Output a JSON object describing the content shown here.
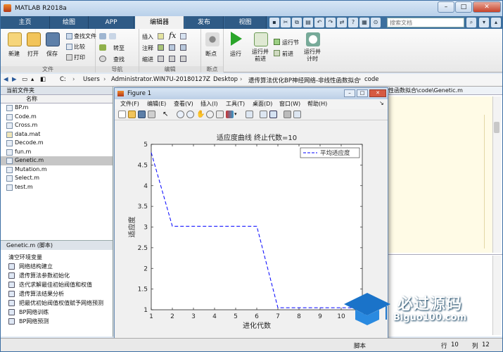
{
  "app_title": "MATLAB R2018a",
  "tabs": [
    "主页",
    "绘图",
    "APP",
    "编辑器",
    "发布",
    "视图"
  ],
  "active_tab": "编辑器",
  "search_placeholder": "搜索文档",
  "ribbon": {
    "new": "新建",
    "open": "打开",
    "save": "保存",
    "find_files": "查找文件",
    "compare": "比较",
    "print": "打印",
    "file_group": "文件",
    "goto": "转至",
    "find": "查找",
    "nav_group": "导航",
    "insert": "插入",
    "comment": "注释",
    "indent": "缩进",
    "fx": "fx",
    "edit_group": "编辑",
    "breakpoints": "断点",
    "bp_group": "断点",
    "run": "运行",
    "run_advance": "运行并\n前进",
    "run_section": "运行节",
    "advance": "前进",
    "run_time": "运行并\n计时"
  },
  "address": [
    "C:",
    "Users",
    "Administrator.WIN7U-20180127Z",
    "Desktop",
    "遗传算法优化BP神经网络-非线性函数拟合",
    "code"
  ],
  "current_folder_title": "当前文件夹",
  "name_col": "名称",
  "files": [
    "BP.m",
    "Code.m",
    "Cross.m",
    "data.mat",
    "Decode.m",
    "fun.m",
    "Genetic.m",
    "Mutation.m",
    "Select.m",
    "test.m"
  ],
  "selected_file": "Genetic.m",
  "details_title": "Genetic.m  (脚本)",
  "tasks": [
    "清空环境变量",
    "网络结构建立",
    "遗传算法参数初始化",
    "迭代求解最佳初始阀值和权值",
    "遗传算法结果分析",
    "把最优初始阀值权值赋予网络预测",
    "BP网络训练",
    "BP网络预测"
  ],
  "editor_path": "性函数拟合\\code\\Genetic.m",
  "figure": {
    "title": "Figure 1",
    "menu": [
      "文件(F)",
      "编辑(E)",
      "查看(V)",
      "插入(I)",
      "工具(T)",
      "桌面(D)",
      "窗口(W)",
      "帮助(H)"
    ]
  },
  "status": {
    "mode": "脚本",
    "row_label": "行",
    "row": "10",
    "col_label": "列",
    "col": "12"
  },
  "watermark": {
    "cn": "必过源码",
    "en": "Biguo100.com"
  },
  "chart_data": {
    "type": "line",
    "title": "适应度曲线  终止代数=10",
    "xlabel": "进化代数",
    "ylabel": "适应度",
    "xlim": [
      1,
      11
    ],
    "ylim": [
      1,
      5
    ],
    "xticks": [
      1,
      2,
      3,
      4,
      5,
      6,
      7,
      8,
      9,
      10,
      11
    ],
    "yticks": [
      1,
      1.5,
      2,
      2.5,
      3,
      3.5,
      4,
      4.5,
      5
    ],
    "series": [
      {
        "name": "平均适应度",
        "color": "#0000ff",
        "dash": true,
        "x": [
          1,
          2,
          3,
          4,
          5,
          6,
          7,
          8,
          9,
          10,
          11
        ],
        "y": [
          4.8,
          3.02,
          3.02,
          3.02,
          3.02,
          3.02,
          1.05,
          1.05,
          1.05,
          1.05,
          1.05
        ]
      }
    ],
    "legend": "top-right",
    "grid": false
  }
}
